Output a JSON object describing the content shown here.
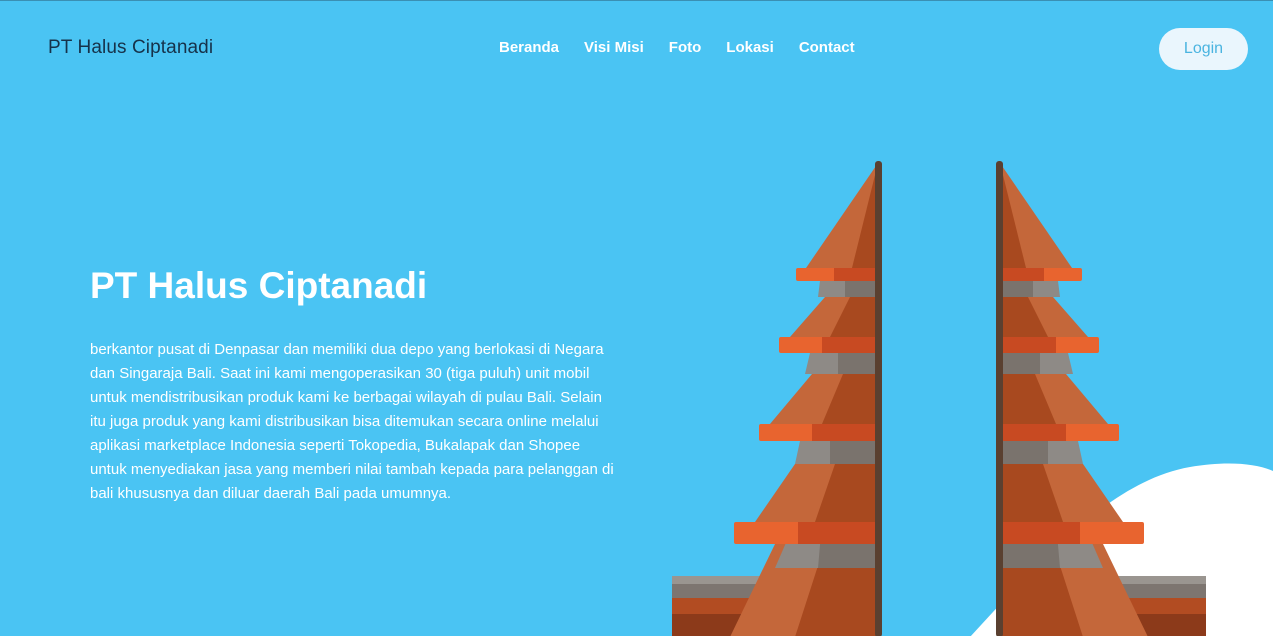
{
  "header": {
    "brand": "PT Halus Ciptanadi",
    "nav": [
      {
        "label": "Beranda"
      },
      {
        "label": "Visi Misi"
      },
      {
        "label": "Foto"
      },
      {
        "label": "Lokasi"
      },
      {
        "label": "Contact"
      }
    ],
    "login_label": "Login"
  },
  "hero": {
    "title": "PT Halus Ciptanadi",
    "description": "berkantor pusat di Denpasar dan memiliki dua depo yang berlokasi di Negara dan Singaraja Bali. Saat ini kami mengoperasikan 30 (tiga puluh) unit mobil untuk mendistribusikan produk kami ke berbagai wilayah di pulau Bali. Selain itu juga produk yang kami distribusikan bisa ditemukan secara online melalui aplikasi marketplace Indonesia seperti Tokopedia, Bukalapak dan Shopee untuk menyediakan jasa yang memberi nilai tambah kepada para pelanggan di bali khususnya dan diluar daerah Bali pada umumnya."
  },
  "illustration": {
    "subject": "balinese-split-gate-candi-bentar",
    "colors": {
      "background": "#4ac4f3",
      "roof_light": "#c4673a",
      "roof_dark": "#a8491f",
      "ledge": "#e8642f",
      "ledge_dark": "#c84a22",
      "stone": "#8e8a86",
      "stone_dark": "#7a736d",
      "pillar_edge": "#5a4030",
      "wall": "#b24c22",
      "hill": "#ffffff"
    }
  }
}
